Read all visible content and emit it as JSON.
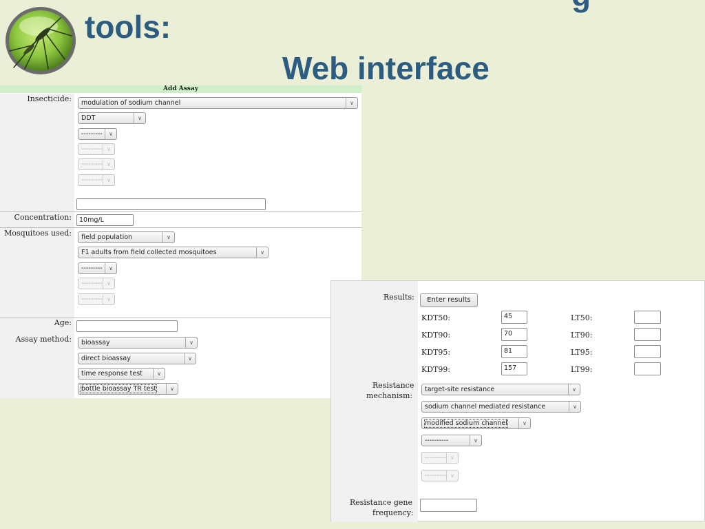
{
  "header": {
    "title_line1": "tools:",
    "title_tail": "g",
    "title_line2": "Web interface",
    "logo_icon": "mosquito-icon"
  },
  "assay_form": {
    "title": "Add Assay",
    "insecticide": {
      "label": "Insecticide:",
      "class_value": "modulation of sodium channel",
      "compound_value": "DDT",
      "level3_value": "---------",
      "disabled_value": "---------",
      "other_value": ""
    },
    "concentration": {
      "label": "Concentration:",
      "value": "10mg/L"
    },
    "mosquitoes": {
      "label": "Mosquitoes used:",
      "type_value": "field population",
      "origin_value": "F1 adults from field collected mosquitoes",
      "level3_value": "---------",
      "disabled_value": "---------"
    },
    "age": {
      "label": "Age:",
      "value": ""
    },
    "assay_method": {
      "label": "Assay method:",
      "values": [
        "bioassay",
        "direct bioassay",
        "time response test",
        "bottle bioassay TR test"
      ]
    }
  },
  "results_form": {
    "results_label": "Results:",
    "enter_button": "Enter results",
    "kdt": [
      {
        "label": "KDT50:",
        "value": "45"
      },
      {
        "label": "KDT90:",
        "value": "70"
      },
      {
        "label": "KDT95:",
        "value": "81"
      },
      {
        "label": "KDT99:",
        "value": "157"
      }
    ],
    "lt": [
      {
        "label": "LT50:",
        "value": ""
      },
      {
        "label": "LT90:",
        "value": ""
      },
      {
        "label": "LT95:",
        "value": ""
      },
      {
        "label": "LT99:",
        "value": ""
      }
    ],
    "mechanism_label_1": "Resistance",
    "mechanism_label_2": "mechanism:",
    "mechanism_values": [
      "target-site resistance",
      "sodium channel mediated resistance",
      "modified sodium channel",
      "----------"
    ],
    "mechanism_disabled_value": "---------",
    "gene_label_1": "Resistance gene",
    "gene_label_2": "frequency:",
    "gene_value": ""
  }
}
